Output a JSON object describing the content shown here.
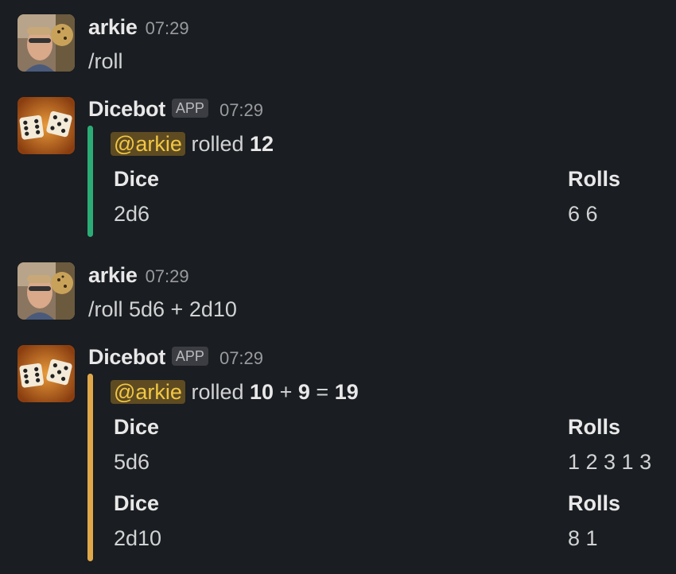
{
  "messages": [
    {
      "author": "arkie",
      "time": "07:29",
      "text": "/roll"
    },
    {
      "author": "Dicebot",
      "badge": "APP",
      "time": "07:29",
      "mention": "@arkie",
      "rolled_word": "rolled",
      "result": "12",
      "accent_color": "#2bac76",
      "fields": [
        {
          "dice_label": "Dice",
          "dice_value": "2d6",
          "rolls_label": "Rolls",
          "rolls_value": "6 6"
        }
      ]
    },
    {
      "author": "arkie",
      "time": "07:29",
      "text": "/roll 5d6 + 2d10"
    },
    {
      "author": "Dicebot",
      "badge": "APP",
      "time": "07:29",
      "mention": "@arkie",
      "rolled_word": "rolled",
      "result_a": "10",
      "plus": "+",
      "result_b": "9",
      "equals": "=",
      "total": "19",
      "accent_color": "#e0a84a",
      "fields": [
        {
          "dice_label": "Dice",
          "dice_value": "5d6",
          "rolls_label": "Rolls",
          "rolls_value": "1 2 3 1 3"
        },
        {
          "dice_label": "Dice",
          "dice_value": "2d10",
          "rolls_label": "Rolls",
          "rolls_value": "8 1"
        }
      ]
    }
  ],
  "avatars": {
    "user": "user-photo-avatar",
    "bot": "dice-avatar"
  }
}
